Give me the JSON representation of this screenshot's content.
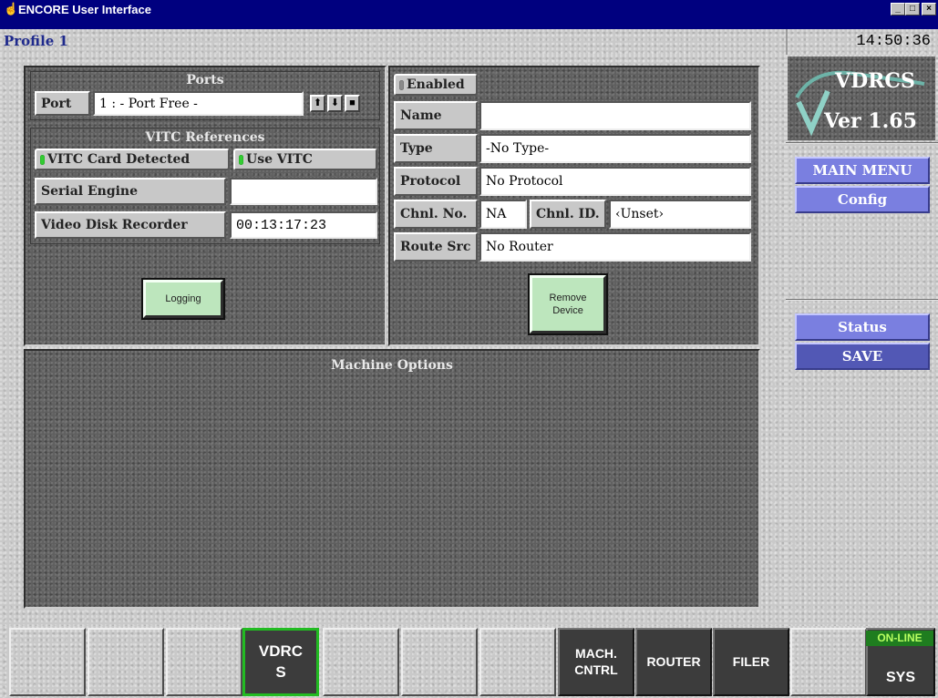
{
  "window": {
    "title": "ENCORE User Interface",
    "controls": [
      "minimize",
      "maximize",
      "close"
    ]
  },
  "header": {
    "profile": "Profile 1",
    "time": "14:50:36"
  },
  "ports": {
    "title": "Ports",
    "port_label": "Port",
    "port_value": "1 : - Port Free -"
  },
  "vitc": {
    "title": "VITC References",
    "card_detected": "VITC Card Detected",
    "use_vitc": "Use VITC",
    "serial_engine_label": "Serial Engine",
    "serial_engine_value": "",
    "vdr_label": "Video Disk Recorder",
    "vdr_value": "00:13:17:23"
  },
  "buttons": {
    "logging": "Logging",
    "remove_device_line1": "Remove",
    "remove_device_line2": "Device"
  },
  "device": {
    "enabled": "Enabled",
    "name_label": "Name",
    "name_value": "",
    "type_label": "Type",
    "type_value": "-No Type-",
    "protocol_label": "Protocol",
    "protocol_value": "No Protocol",
    "chnl_no_label": "Chnl. No.",
    "chnl_no_value": "NA",
    "chnl_id_label": "Chnl. ID.",
    "chnl_id_value": "‹Unset›",
    "route_src_label": "Route Src",
    "route_src_value": "No Router"
  },
  "machine_options": {
    "title": "Machine Options"
  },
  "sidebar": {
    "logo_line1": "VDRCS",
    "logo_line2": "Ver 1.65",
    "main_menu": "MAIN MENU",
    "config": "Config",
    "status": "Status",
    "save": "SAVE"
  },
  "footer": {
    "vdrcs_line1": "VDRC",
    "vdrcs_line2": "S",
    "mach_line1": "MACH.",
    "mach_line2": "CNTRL",
    "router": "ROUTER",
    "filer": "FILER",
    "online": "ON-LINE",
    "sys": "SYS"
  },
  "colors": {
    "title_bar": "#00007f",
    "accent_green": "#22bb22",
    "menu_blue": "#7a7fe0"
  }
}
